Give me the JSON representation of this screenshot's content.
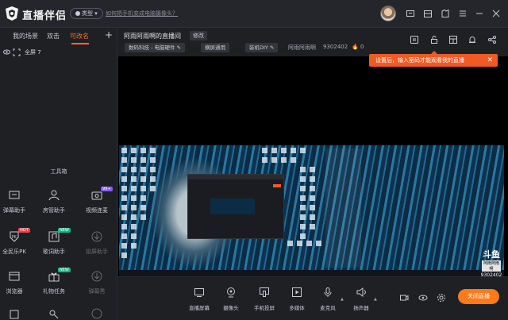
{
  "app": {
    "logo_text": "直播伴侣",
    "type_label": "类型",
    "help_link": "如何把手机变成电脑摄像头？"
  },
  "scene_tabs": [
    {
      "label": "我的场景",
      "active": false
    },
    {
      "label": "双击",
      "active": false
    },
    {
      "label": "可改名",
      "active": true
    }
  ],
  "scene": {
    "name": "全屏 7"
  },
  "toolbox": {
    "title": "工具箱",
    "tools": [
      {
        "label": "弹幕助手",
        "icon": "chat-icon",
        "dim": false
      },
      {
        "label": "房管助手",
        "icon": "admin-icon",
        "dim": false
      },
      {
        "label": "视频连麦",
        "icon": "video-call-icon",
        "dim": false,
        "badge": "99+"
      },
      {
        "label": "全民乐PK",
        "icon": "pk-icon",
        "dim": false,
        "badge": "HOT"
      },
      {
        "label": "歌词助手",
        "icon": "lyrics-icon",
        "dim": false,
        "badge": "NEW"
      },
      {
        "label": "投屏助手",
        "icon": "download-icon",
        "dim": true
      },
      {
        "label": "浏览器",
        "icon": "browser-icon",
        "dim": false
      },
      {
        "label": "礼物任务",
        "icon": "gift-icon",
        "dim": false,
        "badge": "NEW"
      },
      {
        "label": "弹幕秀",
        "icon": "download-icon",
        "dim": true
      }
    ]
  },
  "room": {
    "title": "阿雨阿雨啊的直播间",
    "edit_label": "修改",
    "tags": [
      "数码科技 - 电脑硬件",
      "横屏通用",
      "装机DIY"
    ],
    "owner": "阿雨阿雨啊",
    "room_id": "9302402",
    "heat": "0"
  },
  "tip": {
    "text": "设置后，输入密码才能观看我的直播"
  },
  "watermark": {
    "brand": "斗鱼",
    "name": "阿雨阿雨啊",
    "id": "9302402"
  },
  "controls": [
    {
      "label": "直播屏幕",
      "icon": "screen-cast-icon"
    },
    {
      "label": "摄像头",
      "icon": "camera-icon"
    },
    {
      "label": "手机投屏",
      "icon": "phone-cast-icon"
    },
    {
      "label": "多媒体",
      "icon": "media-icon"
    },
    {
      "label": "麦克风",
      "icon": "microphone-icon"
    },
    {
      "label": "扬声器",
      "icon": "speaker-icon"
    }
  ],
  "live_button": {
    "label": "关闭直播"
  },
  "colors": {
    "accent": "#ff6a2b",
    "tip_bg": "#f15a24",
    "bg": "#1c1d21",
    "panel": "#1f2024"
  }
}
